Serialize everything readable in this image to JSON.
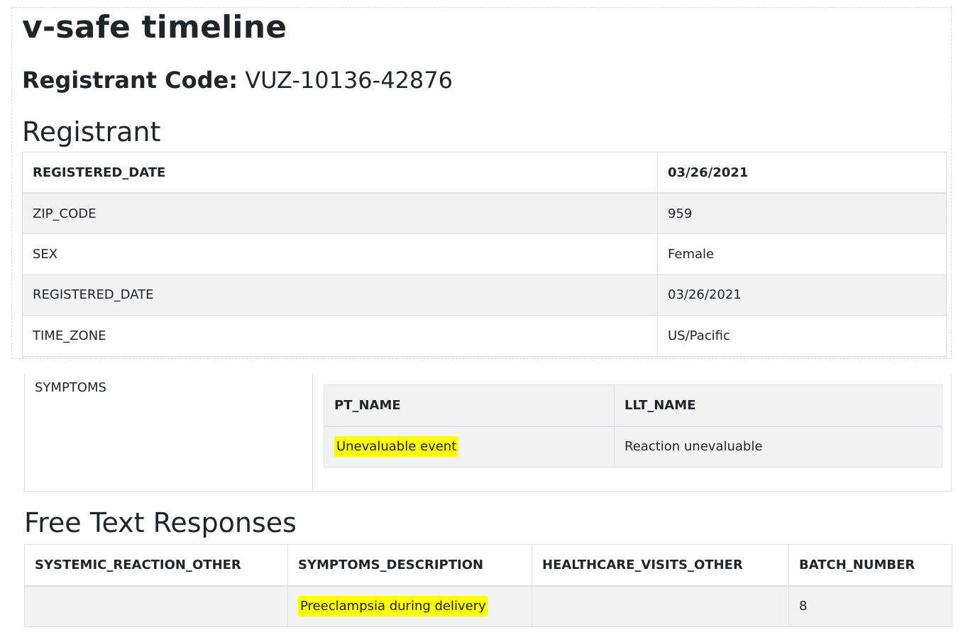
{
  "page_title": "v-safe timeline",
  "registrant_code": {
    "label": "Registrant Code:",
    "value": "VUZ-10136-42876"
  },
  "registrant": {
    "title": "Registrant",
    "header": [
      "REGISTERED_DATE",
      "03/26/2021"
    ],
    "rows": [
      [
        "ZIP_CODE",
        "959"
      ],
      [
        "SEX",
        "Female"
      ],
      [
        "REGISTERED_DATE",
        "03/26/2021"
      ],
      [
        "TIME_ZONE",
        "US/Pacific"
      ]
    ]
  },
  "symptoms": {
    "label": "SYMPTOMS",
    "columns": [
      "PT_NAME",
      "LLT_NAME"
    ],
    "rows": [
      [
        "Unevaluable event",
        "Reaction unevaluable"
      ]
    ]
  },
  "free_text": {
    "title": "Free Text Responses",
    "columns": [
      "SYSTEMIC_REACTION_OTHER",
      "SYMPTOMS_DESCRIPTION",
      "HEALTHCARE_VISITS_OTHER",
      "BATCH_NUMBER"
    ],
    "rows": [
      [
        "",
        "Preeclampsia during delivery",
        "",
        "8"
      ]
    ]
  },
  "colors": {
    "highlight": "#ffff00",
    "stripe": "#f2f2f2",
    "border": "#dee2e6",
    "text": "#212529"
  }
}
